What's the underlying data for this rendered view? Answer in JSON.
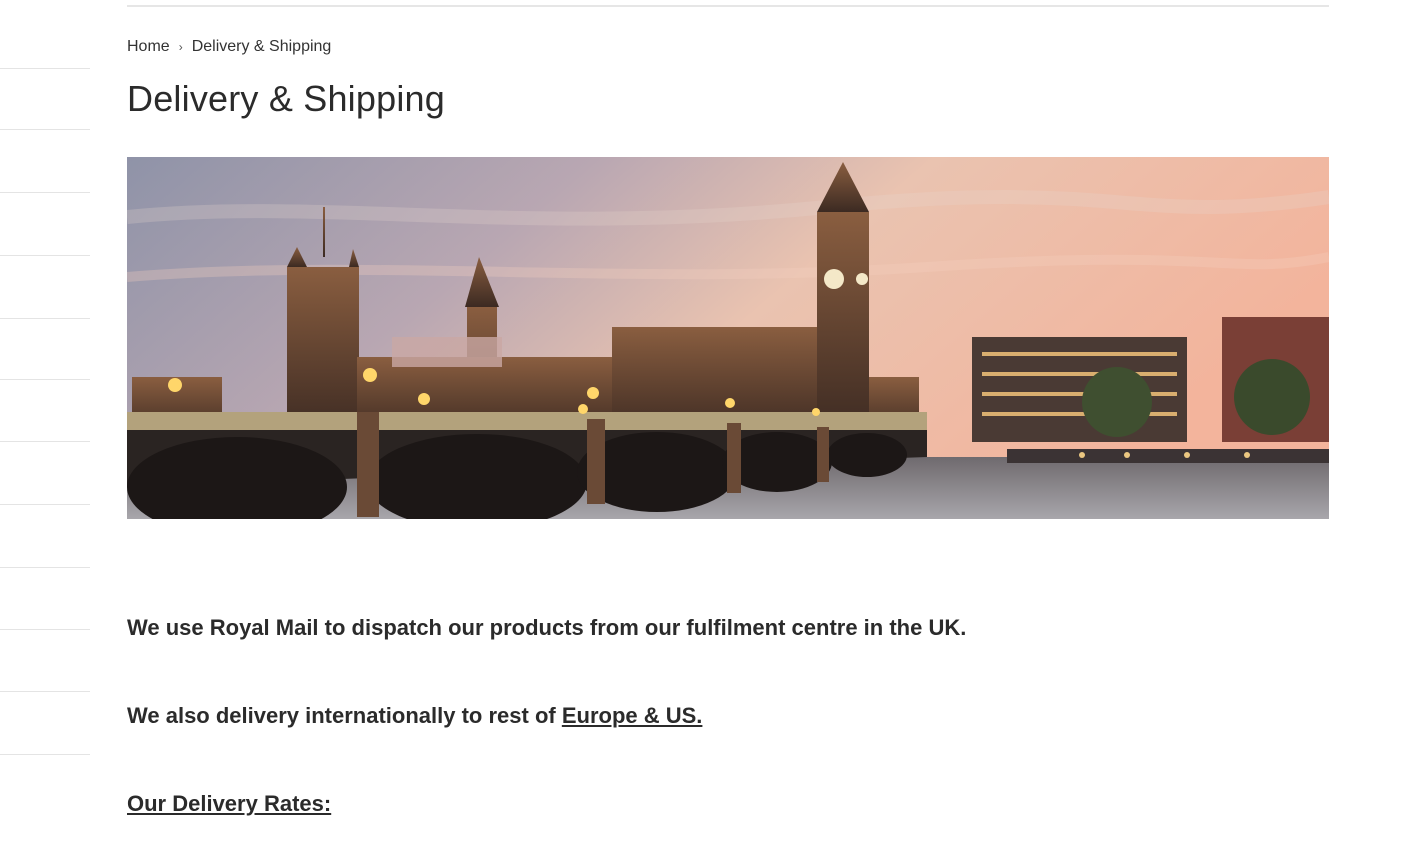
{
  "breadcrumb": {
    "home": "Home",
    "separator": "›",
    "current": "Delivery & Shipping"
  },
  "page": {
    "title": "Delivery & Shipping"
  },
  "hero": {
    "icon": "london-skyline-image",
    "colors": {
      "sky_top": "#8a8fa6",
      "sky_glow": "#f2b9a0",
      "stone": "#6b4a35",
      "water": "#7d7a80"
    }
  },
  "content": {
    "p1": "We use Royal Mail to dispatch our products from our fulfilment centre in the UK.",
    "p2_prefix": "We also delivery internationally to rest of ",
    "p2_link": "Europe & US.",
    "rates_heading": "Our Delivery Rates:"
  }
}
